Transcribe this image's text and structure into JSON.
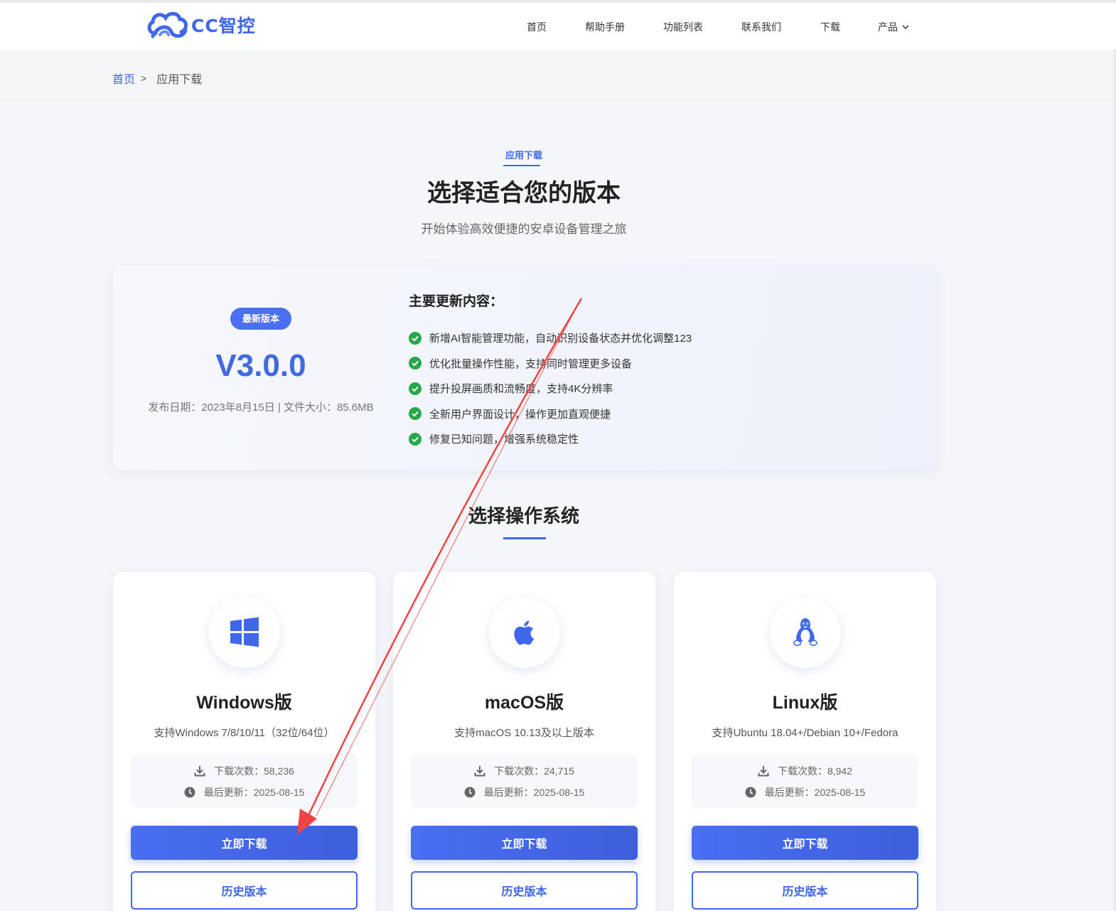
{
  "header": {
    "logo_text": "CC智控",
    "nav": [
      {
        "label": "首页"
      },
      {
        "label": "帮助手册"
      },
      {
        "label": "功能列表"
      },
      {
        "label": "联系我们"
      },
      {
        "label": "下载"
      },
      {
        "label": "产品"
      }
    ]
  },
  "breadcrumb": {
    "home": "首页",
    "separator": ">",
    "current": "应用下载"
  },
  "hero": {
    "eyebrow": "应用下载",
    "title": "选择适合您的版本",
    "subtitle": "开始体验高效便捷的安卓设备管理之旅"
  },
  "latest": {
    "badge": "最新版本",
    "version": "V3.0.0",
    "meta": "发布日期：2023年8月15日 | 文件大小：85.6MB",
    "changes_title": "主要更新内容：",
    "changes": [
      "新增AI智能管理功能，自动识别设备状态并优化调整123",
      "优化批量操作性能，支持同时管理更多设备",
      "提升投屏画质和流畅度，支持4K分辨率",
      "全新用户界面设计，操作更加直观便捷",
      "修复已知问题，增强系统稳定性"
    ]
  },
  "os_section": {
    "title": "选择操作系统",
    "cards": [
      {
        "icon": "windows-icon",
        "name": "Windows版",
        "support": "支持Windows 7/8/10/11（32位/64位）",
        "downloads": "下载次数：58,236",
        "updated": "最后更新：2025-08-15",
        "download_label": "立即下载",
        "history_label": "历史版本"
      },
      {
        "icon": "apple-icon",
        "name": "macOS版",
        "support": "支持macOS 10.13及以上版本",
        "downloads": "下载次数：24,715",
        "updated": "最后更新：2025-08-15",
        "download_label": "立即下载",
        "history_label": "历史版本"
      },
      {
        "icon": "linux-icon",
        "name": "Linux版",
        "support": "支持Ubuntu 18.04+/Debian 10+/Fedora",
        "downloads": "下载次数：8,942",
        "updated": "最后更新：2025-08-15",
        "download_label": "立即下载",
        "history_label": "历史版本"
      }
    ]
  },
  "colors": {
    "accent": "#3f67ec",
    "check_green": "#27a84a",
    "annotation_red": "#ee4444"
  }
}
